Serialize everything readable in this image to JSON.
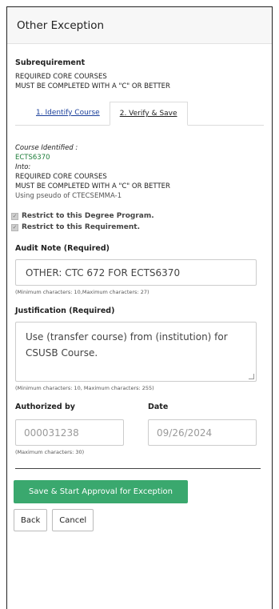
{
  "header": {
    "title": "Other Exception"
  },
  "subrequirement": {
    "label": "Subrequirement",
    "line1": "REQUIRED CORE COURSES",
    "line2": "MUST BE COMPLETED WITH A \"C\" OR BETTER"
  },
  "tabs": [
    {
      "label": "1. Identify Course",
      "active": false
    },
    {
      "label": "2. Verify & Save",
      "active": true
    }
  ],
  "course": {
    "identified_label": "Course Identified :",
    "identified_value": "ECTS6370",
    "into_label": "Into:",
    "into_line1": "REQUIRED CORE COURSES",
    "into_line2": "MUST BE COMPLETED WITH A \"C\" OR BETTER",
    "pseudo": "Using pseudo of CTECSEMMA-1"
  },
  "checks": [
    {
      "label": "Restrict to this Degree Program.",
      "checked": true
    },
    {
      "label": "Restrict to this Requirement.",
      "checked": true
    }
  ],
  "audit_note": {
    "label": "Audit Note (Required)",
    "value": "OTHER: CTC 672 FOR ECTS6370",
    "hint": "(Minimum characters: 10,Maximum characters: 27)"
  },
  "justification": {
    "label": "Justification (Required)",
    "value": "Use (transfer course) from (institution) for CSUSB Course.",
    "hint": "(Minimum characters: 10, Maximum characters: 255)"
  },
  "authorized": {
    "label": "Authorized by",
    "placeholder": "000031238",
    "hint": "(Maximum characters: 30)"
  },
  "date": {
    "label": "Date",
    "placeholder": "09/26/2024"
  },
  "buttons": {
    "save": "Save & Start Approval for Exception",
    "back": "Back",
    "cancel": "Cancel"
  },
  "colors": {
    "primary_button": "#3aa86e",
    "course_value": "#1e7d3a",
    "tab_link": "#1a3f9b"
  }
}
